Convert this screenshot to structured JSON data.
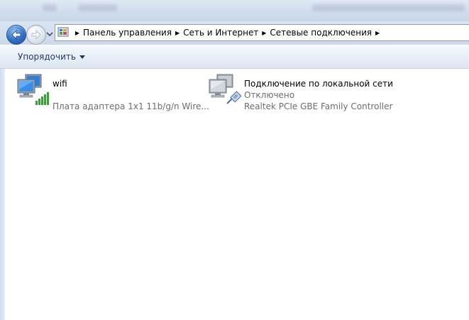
{
  "address_bar": {
    "crumbs": [
      "Панель управления",
      "Сеть и Интернет",
      "Сетевые подключения"
    ]
  },
  "toolbar": {
    "organize_label": "Упорядочить"
  },
  "adapters": [
    {
      "name": "wifi",
      "status": "",
      "device": "Плата адаптера 1x1 11b/g/n Wire...",
      "icon": "wireless-network-icon"
    },
    {
      "name": "Подключение по локальной сети",
      "status": "Отключено",
      "device": "Realtek PCIe GBE Family Controller",
      "icon": "ethernet-network-icon"
    }
  ],
  "colors": {
    "command_text": "#1e395b",
    "secondary_text": "#6d6d6d",
    "signal_green": "#3aa13a"
  }
}
